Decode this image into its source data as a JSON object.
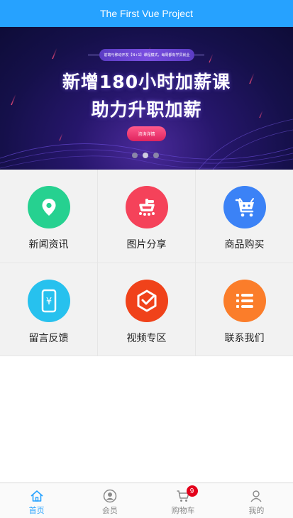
{
  "header": {
    "title": "The First Vue Project"
  },
  "banner": {
    "tagline": "前端与移动开发【N+1】课程模式，每周都有学员就业",
    "headline_line1": "新增180小时加薪课",
    "headline_line2": "助力升职加薪",
    "cta_label": "咨询详情",
    "slide_count": 3,
    "active_slide": 2
  },
  "grid": {
    "items": [
      {
        "label": "新闻资讯",
        "icon": "location-pin-icon",
        "color": "#26d190"
      },
      {
        "label": "图片分享",
        "icon": "dian-logo-icon",
        "color": "#f5425a"
      },
      {
        "label": "商品购买",
        "icon": "shopping-cart-icon",
        "color": "#3b82f6"
      },
      {
        "label": "留言反馈",
        "icon": "phone-yuan-icon",
        "color": "#27c1ee"
      },
      {
        "label": "视频专区",
        "icon": "hexagon-check-icon",
        "color": "#f0421a"
      },
      {
        "label": "联系我们",
        "icon": "list-icon",
        "color": "#fb7d2a"
      }
    ]
  },
  "tabbar": {
    "items": [
      {
        "label": "首页",
        "icon": "home-icon",
        "active": true
      },
      {
        "label": "会员",
        "icon": "member-icon",
        "active": false
      },
      {
        "label": "购物车",
        "icon": "cart-icon",
        "active": false,
        "badge": "9"
      },
      {
        "label": "我的",
        "icon": "user-icon",
        "active": false
      }
    ]
  },
  "colors": {
    "accent": "#26a2ff",
    "badge": "#e4001b"
  }
}
